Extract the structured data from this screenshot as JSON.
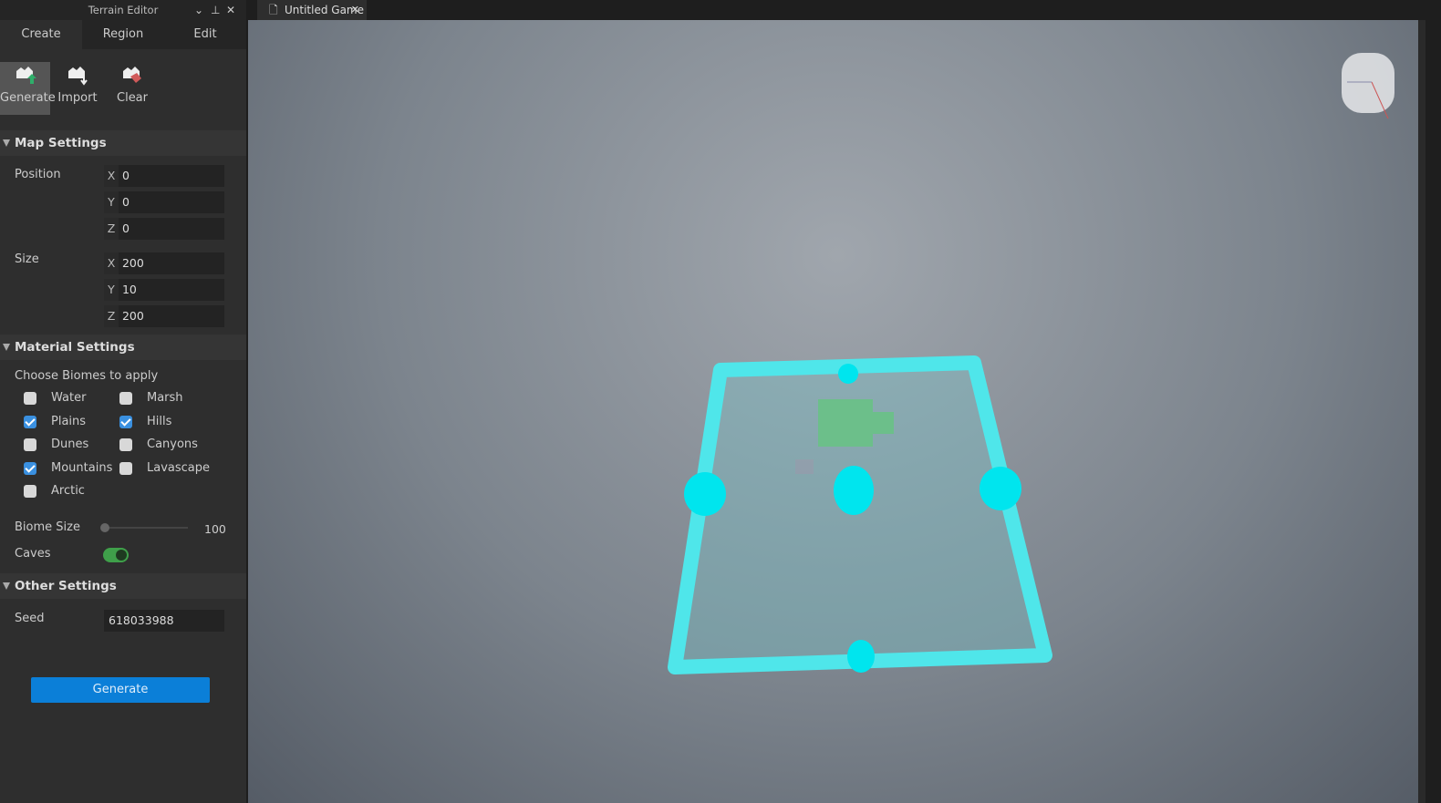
{
  "panel": {
    "title": "Terrain Editor",
    "tabs": [
      "Create",
      "Region",
      "Edit"
    ],
    "active_tab": "Create",
    "tools": [
      {
        "label": "Generate",
        "icon": "terrain-generate-icon"
      },
      {
        "label": "Import",
        "icon": "terrain-import-icon"
      },
      {
        "label": "Clear",
        "icon": "terrain-clear-icon"
      }
    ],
    "map_settings": {
      "title": "Map Settings",
      "position_label": "Position",
      "size_label": "Size",
      "position": {
        "X": "0",
        "Y": "0",
        "Z": "0"
      },
      "size": {
        "X": "200",
        "Y": "10",
        "Z": "200"
      }
    },
    "material_settings": {
      "title": "Material Settings",
      "biomes_label": "Choose Biomes to apply",
      "biomes": [
        {
          "label": "Water",
          "checked": false
        },
        {
          "label": "Marsh",
          "checked": false
        },
        {
          "label": "Plains",
          "checked": true
        },
        {
          "label": "Hills",
          "checked": true
        },
        {
          "label": "Dunes",
          "checked": false
        },
        {
          "label": "Canyons",
          "checked": false
        },
        {
          "label": "Mountains",
          "checked": true
        },
        {
          "label": "Lavascape",
          "checked": false
        },
        {
          "label": "Arctic",
          "checked": false
        }
      ],
      "biome_size_label": "Biome Size",
      "biome_size": "100",
      "caves_label": "Caves",
      "caves": true
    },
    "other_settings": {
      "title": "Other Settings",
      "seed_label": "Seed",
      "seed": "618033988"
    },
    "generate_button": "Generate"
  },
  "document_tab": {
    "label": "Untitled Game"
  },
  "colors": {
    "accent": "#0b7fd8",
    "region": "#40e0e8",
    "toggle": "#3fa04a"
  }
}
